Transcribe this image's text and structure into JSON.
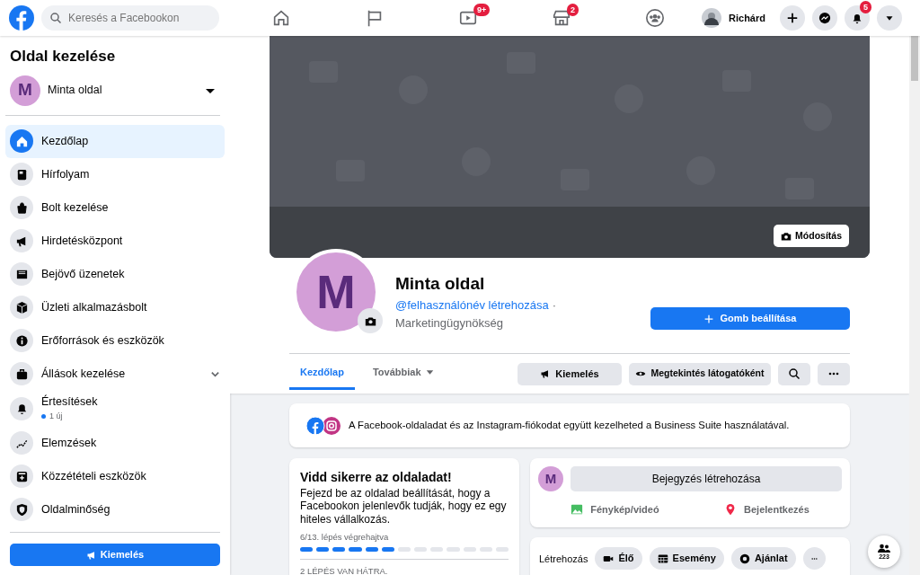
{
  "topbar": {
    "search": {
      "placeholder": "Keresés a Facebookon"
    },
    "nav": [
      {
        "badged": false
      },
      {
        "badged": false
      },
      {
        "badged": true,
        "badge": "9+"
      },
      {
        "badged": true,
        "badge": "2"
      },
      {
        "badged": false
      }
    ],
    "user": {
      "name": "Richárd"
    },
    "actions": [
      {
        "badged": false
      },
      {
        "badged": false
      },
      {
        "badged": true,
        "badge": "5"
      },
      {
        "badged": false
      }
    ]
  },
  "sidebar": {
    "title": "Oldal kezelése",
    "page": {
      "initial": "M",
      "name": "Minta oldal"
    },
    "items": [
      {
        "label": "Kezdőlap",
        "selected": true
      },
      {
        "label": "Hírfolyam",
        "selected": false
      },
      {
        "label": "Bolt kezelése",
        "selected": false
      },
      {
        "label": "Hirdetésközpont",
        "selected": false
      },
      {
        "label": "Bejövő üzenetek",
        "selected": false
      },
      {
        "label": "Üzleti alkalmazásbolt",
        "selected": false
      },
      {
        "label": "Erőforrások és eszközök",
        "selected": false
      },
      {
        "label": "Állások kezelése",
        "selected": false,
        "expandable": true
      },
      {
        "label": "Értesítések",
        "selected": false,
        "sub": "1 új"
      },
      {
        "label": "Elemzések",
        "selected": false
      },
      {
        "label": "Közzétételi eszközök",
        "selected": false
      },
      {
        "label": "Oldalminőség",
        "selected": false
      }
    ],
    "promote_button": "Kiemelés"
  },
  "cover": {
    "kind": "picture",
    "edit_button": "Módosítás"
  },
  "profile": {
    "initial": "M",
    "name": "Minta oldal",
    "username_link": "@felhasználónév létrehozása",
    "separator": "·",
    "category": "Marketingügynökség",
    "action_button": "Gomb beállítása"
  },
  "tabs": [
    {
      "label": "Kezdőlap",
      "selected": true,
      "dropdown": false
    },
    {
      "label": "Továbbiak",
      "selected": false,
      "dropdown": true
    }
  ],
  "tab_actions": {
    "promote": "Kiemelés",
    "view_as": "Megtekintés látogatóként"
  },
  "business_suite": {
    "text": "A Facebook-oldaladat és az Instagram-fiókodat együtt kezelheted a Business Suite használatával."
  },
  "setup_card": {
    "title": "Vidd sikerre az oldaladat!",
    "text": "Fejezd be az oldalad beállítását, hogy a Facebookon jelenlevők tudják, hogy ez egy hiteles vállalkozás.",
    "progress_label": "6/13. lépés végrehajtva",
    "steps": [
      {
        "done": true
      },
      {
        "done": true
      },
      {
        "done": true
      },
      {
        "done": true
      },
      {
        "done": true
      },
      {
        "done": true
      },
      {
        "done": false
      },
      {
        "done": false
      },
      {
        "done": false
      },
      {
        "done": false
      },
      {
        "done": false
      },
      {
        "done": false
      },
      {
        "done": false
      }
    ],
    "remaining": "2 LÉPÉS VAN HÁTRA."
  },
  "composer": {
    "initial": "M",
    "create_post": "Bejegyzés létrehozása",
    "options": [
      "Fénykép/videó",
      "Bejelentkezés"
    ]
  },
  "create_bar": {
    "label": "Létrehozás",
    "buttons": [
      "Élő",
      "Esemény",
      "Ajánlat"
    ]
  },
  "chat_button": {
    "count": "223"
  }
}
